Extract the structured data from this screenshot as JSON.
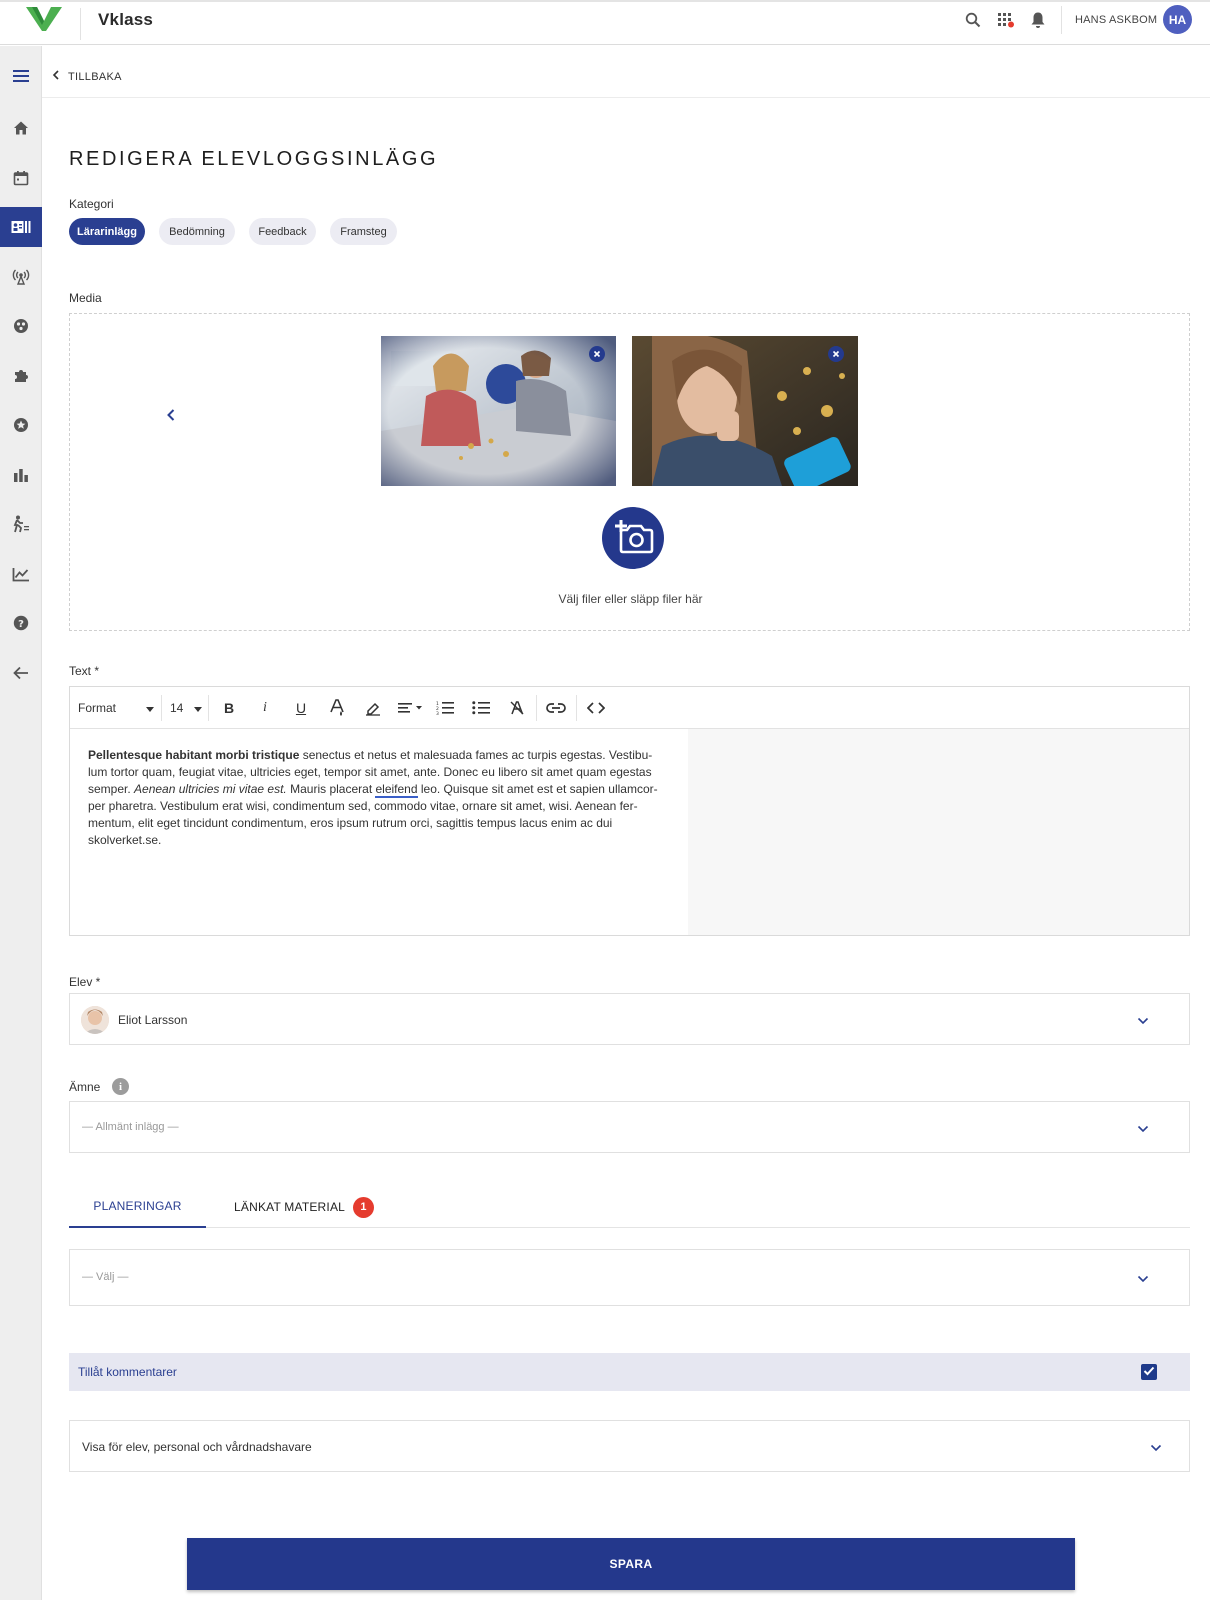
{
  "app": {
    "name": "Vklass"
  },
  "header": {
    "user_name": "HANS ASKBOM",
    "user_initials": "HA"
  },
  "nav": {
    "back_label": "TILLBAKA"
  },
  "page": {
    "title": "REDIGERA ELEVLOGGSINLÄGG"
  },
  "kategori": {
    "label": "Kategori",
    "chips": [
      "Lärarinlägg",
      "Bedömning",
      "Feedback",
      "Framsteg"
    ],
    "selected": "Lärarinlägg"
  },
  "media": {
    "label": "Media",
    "drop_text": "Välj filer eller släpp filer här"
  },
  "text": {
    "label": "Text *",
    "toolbar": {
      "format": "Format",
      "size": "14"
    },
    "content": {
      "bold": "Pellentesque habitant morbi tristique",
      "p1": " senectus et netus et malesuada fames ac turpis egestas. Vestibu-lum tortor quam, feugiat vitae, ultricies eget, tempor sit amet, ante. Donec eu libero sit amet quam egestas semper. ",
      "italic": "Aenean ultricies mi vitae est.",
      "p2": " Mauris placerat ",
      "link": "eleifend",
      "p3": " leo. Quisque sit amet est et sapien ullamcor-per pharetra. Vestibulum erat wisi, condimentum sed, commodo vitae, ornare sit amet, wisi. Aenean fer-mentum, elit eget tincidunt condimentum, eros ipsum rutrum orci, sagittis tempus lacus enim ac dui skolverket.se."
    }
  },
  "elev": {
    "label": "Elev *",
    "value": "Eliot Larsson"
  },
  "amne": {
    "label": "Ämne",
    "placeholder": "— Allmänt inlägg —"
  },
  "tabs": [
    {
      "label": "PLANERINGAR",
      "active": true
    },
    {
      "label": "LÄNKAT MATERIAL",
      "badge": "1"
    }
  ],
  "planering": {
    "placeholder": "— Välj —"
  },
  "comments": {
    "label": "Tillåt kommentarer",
    "checked": true
  },
  "visibility": {
    "value": "Visa för elev, personal och vårdnadshavare"
  },
  "actions": {
    "save": "SPARA"
  },
  "colors": {
    "primary": "#2a3f91",
    "logo_green": "#4caf50",
    "badge_red": "#e53b2e"
  }
}
